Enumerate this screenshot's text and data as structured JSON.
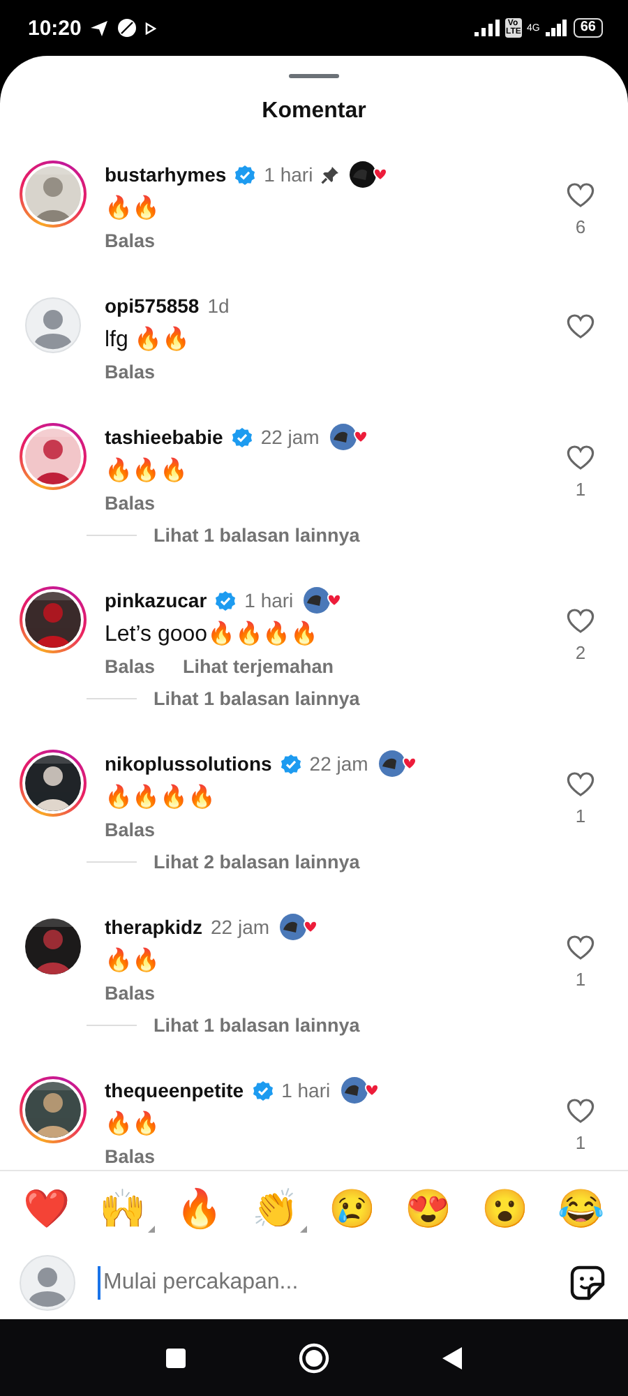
{
  "status_bar": {
    "time": "10:20",
    "volte": "Vo LTE",
    "network": "4G",
    "battery": "66"
  },
  "sheet": {
    "title": "Komentar"
  },
  "comments": [
    {
      "username": "bustarhymes",
      "verified": true,
      "time": "1 hari",
      "pinned": true,
      "creator_liked": true,
      "text": "🔥🔥",
      "reply": "Balas",
      "liked": false,
      "likes": "6",
      "avatar": {
        "kind": "picture",
        "story_ring": true
      }
    },
    {
      "username": "opi575858",
      "verified": false,
      "time": "1d",
      "pinned": false,
      "creator_liked": false,
      "text": "lfg 🔥🔥",
      "reply": "Balas",
      "liked": false,
      "avatar": {
        "kind": "default",
        "story_ring": false
      }
    },
    {
      "username": "tashieebabie",
      "verified": true,
      "time": "22 jam",
      "pinned": false,
      "creator_liked": true,
      "text": "🔥🔥🔥",
      "reply": "Balas",
      "liked": false,
      "likes": "1",
      "avatar": {
        "kind": "picture",
        "story_ring": true
      },
      "more_replies": "Lihat 1 balasan lainnya"
    },
    {
      "username": "pinkazucar",
      "verified": true,
      "time": "1 hari",
      "pinned": false,
      "creator_liked": true,
      "text": "Let’s gooo🔥🔥🔥🔥",
      "reply": "Balas",
      "translate": "Lihat terjemahan",
      "liked": false,
      "likes": "2",
      "avatar": {
        "kind": "picture",
        "story_ring": true
      },
      "more_replies": "Lihat 1 balasan lainnya"
    },
    {
      "username": "nikoplussolutions",
      "verified": true,
      "time": "22 jam",
      "pinned": false,
      "creator_liked": true,
      "text": "🔥🔥🔥🔥",
      "reply": "Balas",
      "liked": false,
      "likes": "1",
      "avatar": {
        "kind": "picture",
        "story_ring": true
      },
      "more_replies": "Lihat 2 balasan lainnya"
    },
    {
      "username": "therapkidz",
      "verified": false,
      "time": "22 jam",
      "pinned": false,
      "creator_liked": true,
      "text": "🔥🔥",
      "reply": "Balas",
      "liked": false,
      "likes": "1",
      "avatar": {
        "kind": "picture",
        "story_ring": false
      },
      "more_replies": "Lihat 1 balasan lainnya"
    },
    {
      "username": "thequeenpetite",
      "verified": true,
      "time": "1 hari",
      "pinned": false,
      "creator_liked": true,
      "text": "🔥🔥",
      "reply": "Balas",
      "liked": false,
      "likes": "1",
      "avatar": {
        "kind": "picture",
        "story_ring": true
      }
    }
  ],
  "reactions": [
    {
      "emoji": "❤️",
      "has_variants": false
    },
    {
      "emoji": "🙌",
      "has_variants": true
    },
    {
      "emoji": "🔥",
      "has_variants": false
    },
    {
      "emoji": "👏",
      "has_variants": true
    },
    {
      "emoji": "😢",
      "has_variants": false
    },
    {
      "emoji": "😍",
      "has_variants": false
    },
    {
      "emoji": "😮",
      "has_variants": false
    },
    {
      "emoji": "😂",
      "has_variants": false
    }
  ],
  "composer": {
    "placeholder": "Mulai percakapan..."
  }
}
